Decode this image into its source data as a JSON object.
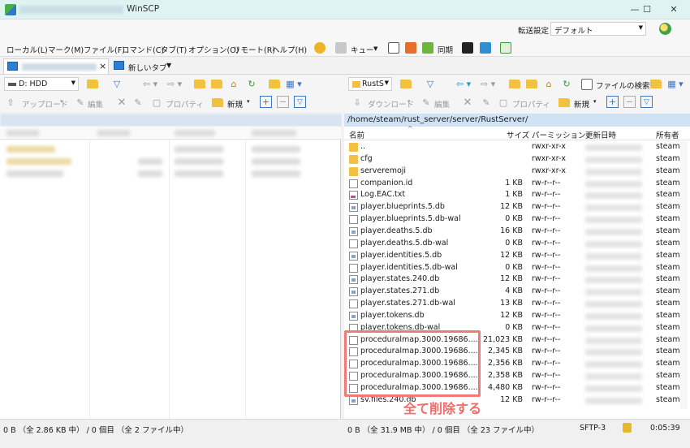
{
  "window": {
    "title": "WinSCP",
    "controls": {
      "minimize": "—",
      "maximize": "☐",
      "close": "✕"
    }
  },
  "menu": {
    "items": [
      "ローカル(L)",
      "マーク(M)",
      "ファイル(F)",
      "コマンド(C)",
      "タブ(T)",
      "オプション(O)",
      "リモート(R)",
      "ヘルプ(H)"
    ],
    "queue_label": "キュー",
    "sync_label": "同期",
    "transfer_settings_label": "転送設定",
    "transfer_settings_value": "デフォルト"
  },
  "tabs": {
    "new_tab_label": "新しいタブ",
    "close": "×"
  },
  "left_toolbar": {
    "drive": "D: HDD",
    "upload": "アップロード",
    "edit": "編集",
    "properties": "プロパティ",
    "new": "新規"
  },
  "right_toolbar": {
    "location": "RustS",
    "find_files": "ファイルの検索",
    "download": "ダウンロード",
    "edit": "編集",
    "properties": "プロパティ",
    "new": "新規"
  },
  "remote": {
    "path": "/home/steam/rust_server/server/RustServer/",
    "columns": {
      "name": "名前",
      "size": "サイズ",
      "permissions": "パーミッション",
      "modified": "更新日時",
      "owner": "所有者"
    },
    "files": [
      {
        "name": "..",
        "size": "",
        "perm": "rwxr-xr-x",
        "owner": "steam",
        "icon": "updir"
      },
      {
        "name": "cfg",
        "size": "",
        "perm": "rwxr-xr-x",
        "owner": "steam",
        "icon": "folder"
      },
      {
        "name": "serveremoji",
        "size": "",
        "perm": "rwxr-xr-x",
        "owner": "steam",
        "icon": "folder"
      },
      {
        "name": "companion.id",
        "size": "1 KB",
        "perm": "rw-r--r--",
        "owner": "steam",
        "icon": "file"
      },
      {
        "name": "Log.EAC.txt",
        "size": "1 KB",
        "perm": "rw-r--r--",
        "owner": "steam",
        "icon": "txt"
      },
      {
        "name": "player.blueprints.5.db",
        "size": "12 KB",
        "perm": "rw-r--r--",
        "owner": "steam",
        "icon": "db"
      },
      {
        "name": "player.blueprints.5.db-wal",
        "size": "0 KB",
        "perm": "rw-r--r--",
        "owner": "steam",
        "icon": "file"
      },
      {
        "name": "player.deaths.5.db",
        "size": "16 KB",
        "perm": "rw-r--r--",
        "owner": "steam",
        "icon": "db"
      },
      {
        "name": "player.deaths.5.db-wal",
        "size": "0 KB",
        "perm": "rw-r--r--",
        "owner": "steam",
        "icon": "file"
      },
      {
        "name": "player.identities.5.db",
        "size": "12 KB",
        "perm": "rw-r--r--",
        "owner": "steam",
        "icon": "db"
      },
      {
        "name": "player.identities.5.db-wal",
        "size": "0 KB",
        "perm": "rw-r--r--",
        "owner": "steam",
        "icon": "file"
      },
      {
        "name": "player.states.240.db",
        "size": "12 KB",
        "perm": "rw-r--r--",
        "owner": "steam",
        "icon": "db"
      },
      {
        "name": "player.states.271.db",
        "size": "4 KB",
        "perm": "rw-r--r--",
        "owner": "steam",
        "icon": "db"
      },
      {
        "name": "player.states.271.db-wal",
        "size": "13 KB",
        "perm": "rw-r--r--",
        "owner": "steam",
        "icon": "file"
      },
      {
        "name": "player.tokens.db",
        "size": "12 KB",
        "perm": "rw-r--r--",
        "owner": "steam",
        "icon": "db"
      },
      {
        "name": "player.tokens.db-wal",
        "size": "0 KB",
        "perm": "rw-r--r--",
        "owner": "steam",
        "icon": "file"
      },
      {
        "name": "proceduralmap.3000.19686....",
        "size": "21,023 KB",
        "perm": "rw-r--r--",
        "owner": "steam",
        "icon": "file"
      },
      {
        "name": "proceduralmap.3000.19686....",
        "size": "2,345 KB",
        "perm": "rw-r--r--",
        "owner": "steam",
        "icon": "file"
      },
      {
        "name": "proceduralmap.3000.19686....",
        "size": "2,356 KB",
        "perm": "rw-r--r--",
        "owner": "steam",
        "icon": "file"
      },
      {
        "name": "proceduralmap.3000.19686....",
        "size": "2,358 KB",
        "perm": "rw-r--r--",
        "owner": "steam",
        "icon": "file"
      },
      {
        "name": "proceduralmap.3000.19686....",
        "size": "4,480 KB",
        "perm": "rw-r--r--",
        "owner": "steam",
        "icon": "file"
      },
      {
        "name": "sv.files.240.db",
        "size": "12 KB",
        "perm": "rw-r--r--",
        "owner": "steam",
        "icon": "db"
      }
    ]
  },
  "annotation": {
    "text": "全て削除する",
    "color": "#f46a6a"
  },
  "status": {
    "left": "0 B （全 2.86 KB 中） / 0 個目 （全 2 ファイル中）",
    "right": "0 B （全 31.9 MB 中） / 0 個目 （全 23 ファイル中）",
    "protocol": "SFTP-3",
    "elapsed": "0:05:39"
  },
  "colors": {
    "title_bar": "#dff3f3",
    "path_bar": "#cfe3f5",
    "folder": "#f2c142",
    "accent": "#2b7fd4"
  }
}
